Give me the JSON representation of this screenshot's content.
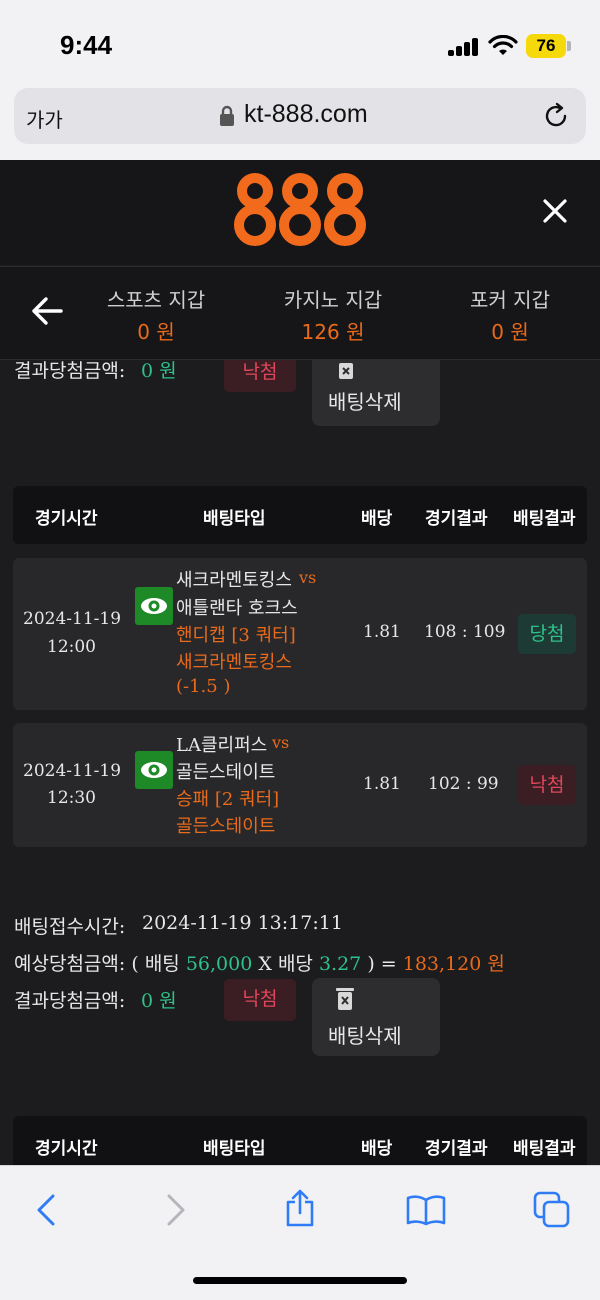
{
  "status": {
    "time": "9:44",
    "battery": "76"
  },
  "browser": {
    "text_size_label": "가가",
    "url": "kt-888.com"
  },
  "header": {
    "logo": "888"
  },
  "wallets": [
    {
      "name": "스포츠 지갑",
      "value": "0 원"
    },
    {
      "name": "카지노 지갑",
      "value": "126 원"
    },
    {
      "name": "포커 지갑",
      "value": "0 원"
    }
  ],
  "bet1": {
    "result_label": "결과당첨금액:",
    "result_amount": "0 원",
    "status": "낙첨",
    "delete_label": "배팅삭제"
  },
  "table_headers": [
    "경기시간",
    "배팅타입",
    "배당",
    "경기결과",
    "배팅결과"
  ],
  "games": [
    {
      "date": "2024-11-19",
      "time": "12:00",
      "home": "새크라멘토킹스",
      "vs": "vs",
      "away": "애틀랜타 호크스",
      "bet_type": "핸디캡 [3 쿼터]",
      "pick": "새크라멘토킹스",
      "line": "(-1.5 )",
      "odds": "1.81",
      "score": "108 : 109",
      "result": "당첨"
    },
    {
      "date": "2024-11-19",
      "time": "12:30",
      "home": "LA클리퍼스",
      "vs": "vs",
      "away": "골든스테이트",
      "bet_type": "승패 [2 쿼터]",
      "pick": "골든스테이트",
      "odds": "1.81",
      "score": "102 : 99",
      "result": "낙첨"
    }
  ],
  "bet2": {
    "time_label": "배팅접수시간:",
    "time_value": "2024-11-19 13:17:11",
    "expected_label": "예상당첨금액:",
    "open_paren": "(",
    "bet_word": "배팅",
    "stake": "56,000",
    "x": "X",
    "odds_word": "배당",
    "odds": "3.27",
    "close_eq": ") =",
    "payout": "183,120 원",
    "result_label": "결과당첨금액:",
    "result_amount": "0 원",
    "status": "낙첨",
    "delete_label": "배팅삭제"
  },
  "colors": {
    "accent": "#e86a1a",
    "win": "#2ec28a",
    "lose": "#e0475a",
    "eye_bg": "#1e8a27"
  },
  "toolbar_icons": [
    "back-icon",
    "forward-icon",
    "share-icon",
    "bookmarks-icon",
    "tabs-icon"
  ]
}
